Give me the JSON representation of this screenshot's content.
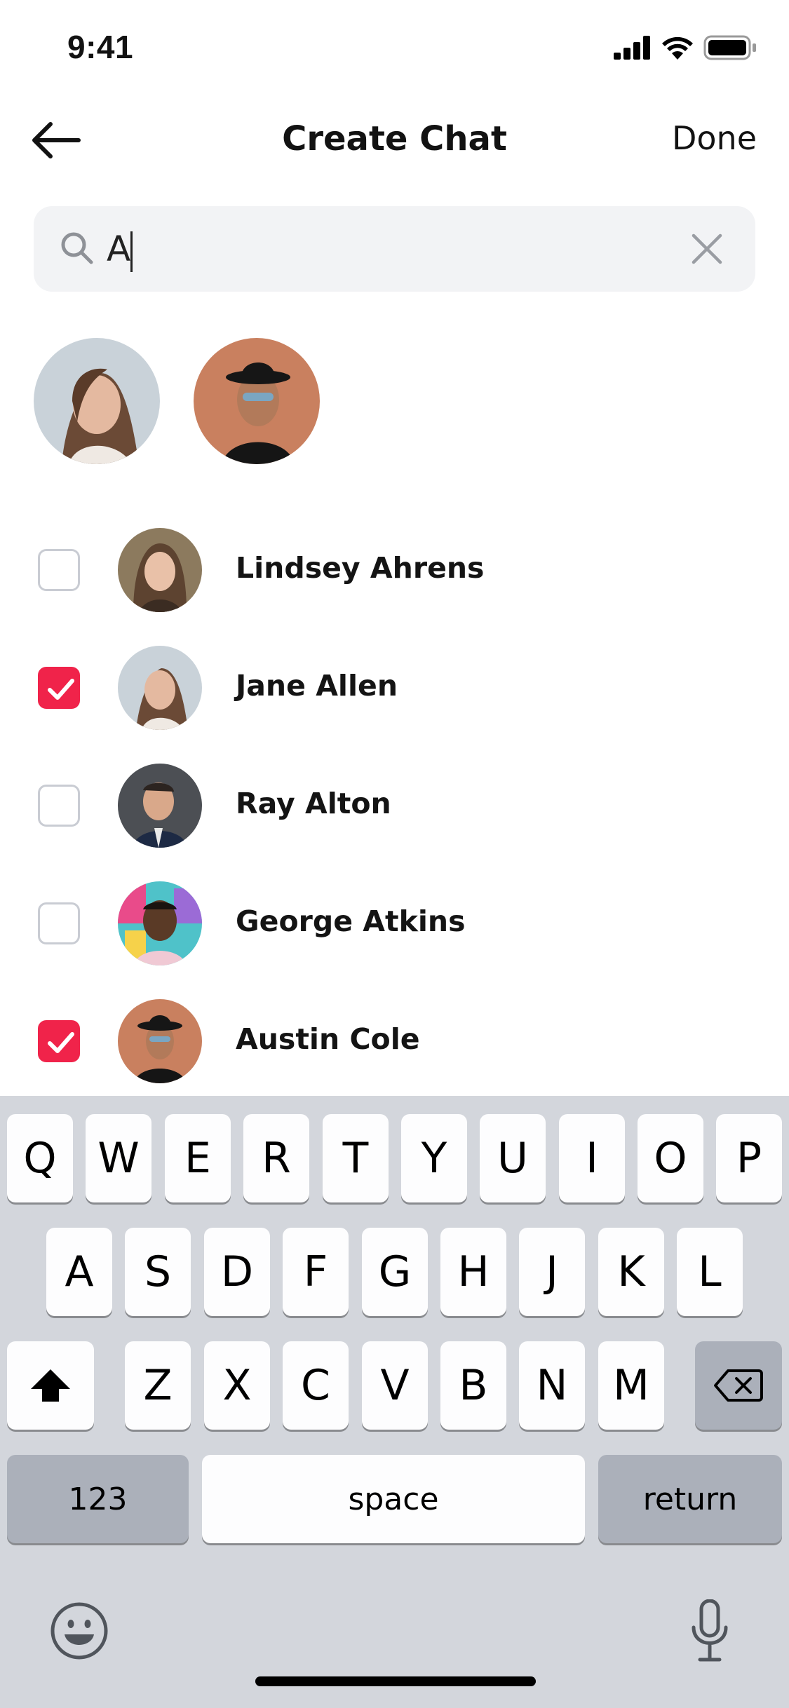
{
  "status_bar": {
    "time": "9:41"
  },
  "nav": {
    "title": "Create Chat",
    "done_label": "Done"
  },
  "search": {
    "value": "A"
  },
  "selected": [
    {
      "name": "Jane Allen",
      "avatar": "woman-long-hair-photo"
    },
    {
      "name": "Austin Cole",
      "avatar": "man-black-hat-sunglasses-photo"
    }
  ],
  "contacts": [
    {
      "name": "Lindsey Ahrens",
      "checked": false
    },
    {
      "name": "Jane Allen",
      "checked": true
    },
    {
      "name": "Ray Alton",
      "checked": false
    },
    {
      "name": "George Atkins",
      "checked": false
    },
    {
      "name": "Austin Cole",
      "checked": true
    }
  ],
  "keyboard": {
    "row1": [
      "Q",
      "W",
      "E",
      "R",
      "T",
      "Y",
      "U",
      "I",
      "O",
      "P"
    ],
    "row2": [
      "A",
      "S",
      "D",
      "F",
      "G",
      "H",
      "J",
      "K",
      "L"
    ],
    "row3": [
      "Z",
      "X",
      "C",
      "V",
      "B",
      "N",
      "M"
    ],
    "numbers_label": "123",
    "space_label": "space",
    "return_label": "return"
  },
  "colors": {
    "accent": "#f0234a",
    "search_bg": "#f2f3f5",
    "keyboard_bg": "#d3d6dc"
  },
  "icons": [
    "back-arrow-icon",
    "search-icon",
    "clear-icon",
    "checkmark-icon",
    "shift-icon",
    "backspace-icon",
    "emoji-icon",
    "microphone-icon"
  ]
}
